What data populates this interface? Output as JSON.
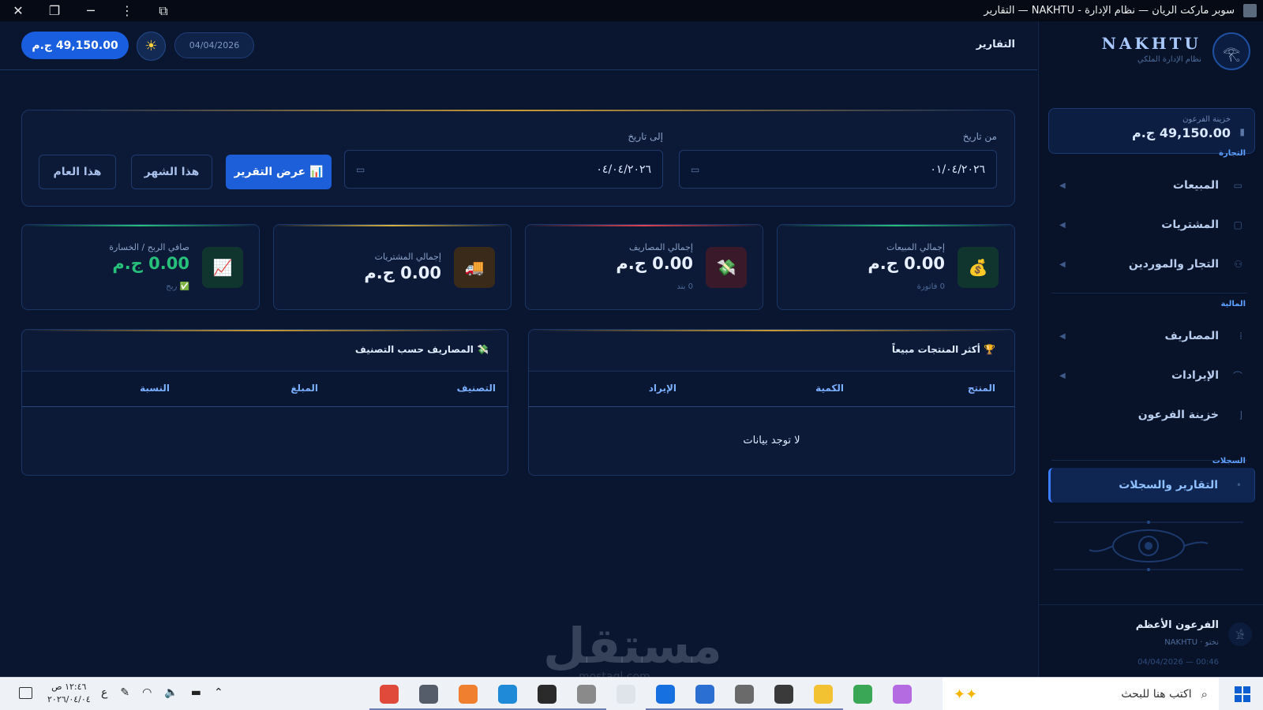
{
  "window": {
    "title": "سوبر ماركت الريان — نظام الإدارة - NAKHTU — التقارير"
  },
  "header": {
    "page_title": "التقارير",
    "balance": "49,150.00 ج.م",
    "date": "04/04/2026"
  },
  "sidebar": {
    "brand_name": "NAKHTU",
    "brand_sub": "نظام الإدارة الملكي",
    "treasury_label": "خزينة الفرعون",
    "treasury_value": "49,150.00 ج.م",
    "sections": {
      "trade": "التجارة",
      "finance": "المالية",
      "records": "السجلات"
    },
    "items": [
      {
        "label": "المبيعات",
        "icon": "receipt-icon"
      },
      {
        "label": "المشتريات",
        "icon": "box-icon"
      },
      {
        "label": "التجار والموردين",
        "icon": "people-icon"
      },
      {
        "label": "المصاريف",
        "icon": "money-out-icon"
      },
      {
        "label": "الإيرادات",
        "icon": "money-in-icon"
      },
      {
        "label": "خزينة الفرعون",
        "icon": "vault-icon"
      },
      {
        "label": "التقارير والسجلات",
        "icon": "report-icon",
        "active": true
      }
    ],
    "user_name": "الفرعون الأعظم",
    "user_role": "نختو · NAKHTU",
    "user_datetime": "04/04/2026 — 00:46"
  },
  "filter": {
    "from_label": "من تاريخ",
    "from_value": "٠١/٠٤/٢٠٢٦",
    "to_label": "إلى تاريخ",
    "to_value": "٠٤/٠٤/٢٠٢٦",
    "show_report": "📊 عرض التقرير",
    "this_month": "هذا الشهر",
    "this_year": "هذا العام"
  },
  "stats": {
    "sales": {
      "label": "إجمالي المبيعات",
      "value": "0.00 ج.م",
      "sub": "0 فاتورة",
      "color": "#27c07a"
    },
    "expenses": {
      "label": "إجمالي المصاريف",
      "value": "0.00 ج.م",
      "sub": "0 بند",
      "color": "#e0424f"
    },
    "purchases": {
      "label": "إجمالي المشتريات",
      "value": "0.00 ج.م",
      "color": "#d9b23c"
    },
    "profit": {
      "label": "صافي الربح / الخسارة",
      "value": "0.00 ج.م",
      "sub": "✅ ربح",
      "color": "#27c07a"
    }
  },
  "top_products": {
    "title": "🏆 أكثر المنتجات مبيعاً",
    "columns": [
      "المنتج",
      "الكمية",
      "الإيراد"
    ],
    "empty": "لا توجد بيانات"
  },
  "expenses_by_category": {
    "title": "💸 المصاريف حسب التصنيف",
    "columns": [
      "التصنيف",
      "المبلغ",
      "النسبة"
    ]
  },
  "watermark": {
    "text": "مستقل",
    "sub": "mostaql.com"
  },
  "taskbar": {
    "search_placeholder": "اكتب هنا للبحث",
    "time": "١٢:٤٦ ص",
    "date": "٢٠٢٦/٠٤/٠٤",
    "lang": "ع",
    "apps": [
      {
        "icon": "chrome-icon",
        "color": "#e04a3a"
      },
      {
        "icon": "settings-icon",
        "color": "#555d6b"
      },
      {
        "icon": "xampp-icon",
        "color": "#f08030"
      },
      {
        "icon": "vscode-icon",
        "color": "#1f8ad8"
      },
      {
        "icon": "app-icon",
        "color": "#2a2a2a"
      },
      {
        "icon": "app-icon",
        "color": "#8a8a8a"
      },
      {
        "icon": "terminal-icon",
        "color": "#dfe4ea"
      },
      {
        "icon": "media-player-icon",
        "color": "#1670e0"
      },
      {
        "icon": "browser-icon",
        "color": "#2a6fd1"
      },
      {
        "icon": "app-icon",
        "color": "#6a6a6a"
      },
      {
        "icon": "app-icon",
        "color": "#3a3a3a"
      },
      {
        "icon": "file-explorer-icon",
        "color": "#f2c232"
      },
      {
        "icon": "chrome-icon",
        "color": "#3aa757"
      },
      {
        "icon": "copilot-icon",
        "color": "#b46ae0"
      }
    ]
  }
}
